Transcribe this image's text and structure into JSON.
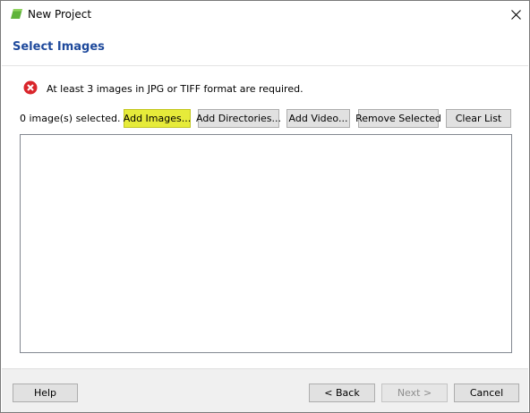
{
  "window": {
    "title": "New Project",
    "icon": "app-icon",
    "close_icon": "close-icon"
  },
  "header": {
    "title": "Select Images"
  },
  "error": {
    "icon": "error-icon",
    "message": "At least 3 images in JPG or TIFF format are required."
  },
  "toolbar": {
    "count_text": "0 image(s) selected.",
    "add_images_label": "Add Images...",
    "add_directories_label": "Add Directories...",
    "add_video_label": "Add Video...",
    "remove_selected_label": "Remove Selected",
    "clear_list_label": "Clear List"
  },
  "image_list": {
    "items": []
  },
  "footer": {
    "help_label": "Help",
    "back_label": "< Back",
    "next_label": "Next >",
    "next_enabled": false,
    "cancel_label": "Cancel"
  },
  "colors": {
    "header_title": "#1f4a9c",
    "highlight_button": "#e6eb3a",
    "error_red": "#d9252b",
    "app_icon_green": "#5fb33a"
  }
}
